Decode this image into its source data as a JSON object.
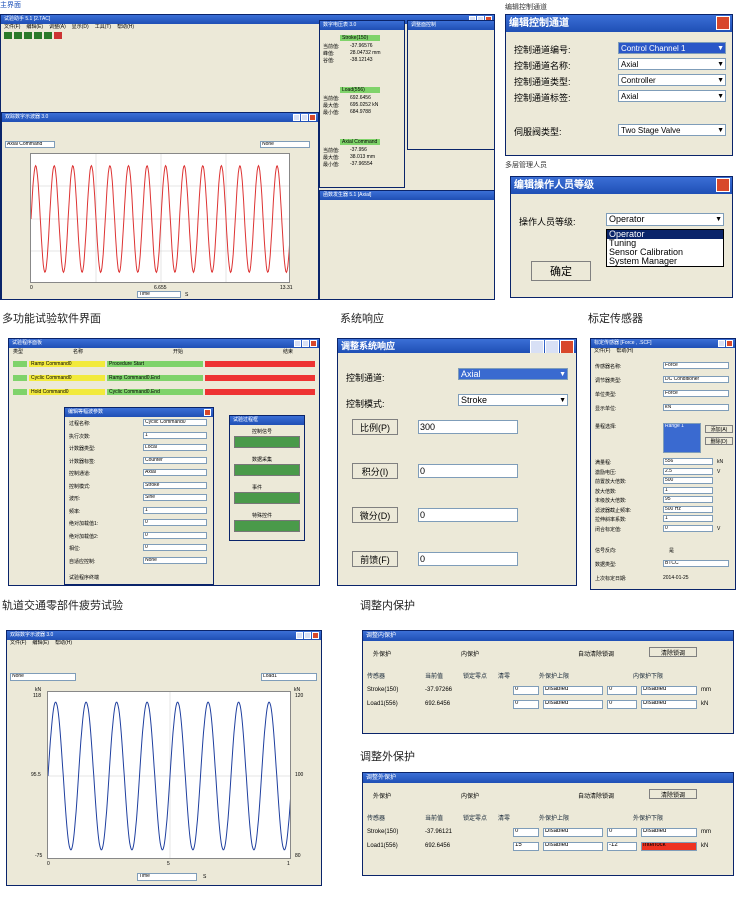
{
  "captions": {
    "main": "主界面",
    "edit_channel": "编辑控制通道",
    "operator": "多层管理人员",
    "software": "多功能试验软件界面",
    "response": "系统响应",
    "calibrate": "标定传感器",
    "rail": "轨道交通零部件疲劳试验",
    "inner": "调整内保护",
    "outer": "调整外保护"
  },
  "channel_dlg": {
    "title": "编辑控制通道",
    "rows": [
      {
        "label": "控制通道编号:",
        "value": "Control Channel 1"
      },
      {
        "label": "控制通道名称:",
        "value": "Axial"
      },
      {
        "label": "控制通道类型:",
        "value": "Controller"
      },
      {
        "label": "控制通道标签:",
        "value": "Axial"
      },
      {
        "label": "伺服阀类型:",
        "value": "Two Stage Valve"
      }
    ]
  },
  "operator_dlg": {
    "title": "编辑操作人员等级",
    "label": "操作人员等级:",
    "selected": "Operator",
    "options": [
      "Operator",
      "Tuning",
      "Sensor Calibration",
      "System Manager"
    ],
    "ok": "确定"
  },
  "main_ui": {
    "title": "试验助手 5.1 [2.TAC]",
    "scope_title": "双踪数字示波器 3.0",
    "meter_title": "数字电压表 3.0",
    "gen_title": "函数发生器 5.1 [Axial]",
    "ctrl_title": "调整面控制",
    "menu": [
      "文件(F)",
      "编辑(E)",
      "调整(A)",
      "显示(D)",
      "工具(T)",
      "帮助(H)"
    ],
    "cmd": "Axial Command",
    "none": "None",
    "time": "Time",
    "sec": "S",
    "x_ticks": [
      "0",
      "6.655",
      "13.31"
    ],
    "meters": [
      {
        "label": "Stroke(150)",
        "line1": "当前值:",
        "line2": "峰值:",
        "line3": "谷值:",
        "v1": "-37.96576",
        "v2": "28.04732 mm",
        "v3": "-38.12143"
      },
      {
        "label": "Load(556)",
        "line1": "当前值:",
        "line2": "最大值:",
        "line3": "最小值:",
        "v1": "692.6456",
        "v2": "695.0252 kN",
        "v3": "684.9788"
      },
      {
        "label": "Axial Command",
        "line1": "当前值:",
        "line2": "最大值:",
        "line3": "最小值:",
        "v1": "-37.956",
        "v2": "38.013 mm",
        "v3": "-37.96554"
      }
    ]
  },
  "rail_ui": {
    "title": "试验程序面板",
    "cols": [
      "类型",
      "名称",
      "开始",
      "结束"
    ],
    "rows": [
      {
        "name": "Ramp Command0",
        "start": "Procedure Start"
      },
      {
        "name": "Cyclic Command0",
        "start": "Ramp Command0.End"
      },
      {
        "name": "Hold Command0",
        "start": "Cyclic Command0.End"
      }
    ],
    "edit_title": "编辑等幅波参数",
    "fields": [
      {
        "label": "过程名称:",
        "value": "Cyclic Command0"
      },
      {
        "label": "执行次数:",
        "value": "1"
      },
      {
        "label": "计数器类型:",
        "value": "Local"
      },
      {
        "label": "计数器标签:",
        "value": "Counter"
      },
      {
        "label": "控制通道:",
        "value": "Axial"
      },
      {
        "label": "控制模式:",
        "value": "Stroke"
      },
      {
        "label": "波形:",
        "value": "Sine"
      },
      {
        "label": "频率:",
        "value": "1"
      },
      {
        "label": "绝对加载值1:",
        "value": "0"
      },
      {
        "label": "绝对加载值2:",
        "value": "0"
      },
      {
        "label": "相位:",
        "value": "0"
      },
      {
        "label": "自适应控制:",
        "value": "None"
      }
    ],
    "allow": "允许",
    "unit_hz": "Hz",
    "times": "Time(s)",
    "deg": "Deg",
    "cycles": "Cycles",
    "footer": "试验程序终端",
    "proc_title": "试验过程框",
    "proc_groups": [
      "控制信号",
      "数据采集",
      "事件",
      "特殊控件"
    ]
  },
  "resp_ui": {
    "title": "调整系统响应",
    "ch_label": "控制通道:",
    "ch_val": "Axial",
    "mode_label": "控制模式:",
    "mode_val": "Stroke",
    "gains": [
      {
        "label": "比例(P)",
        "value": "300"
      },
      {
        "label": "积分(I)",
        "value": "0"
      },
      {
        "label": "微分(D)",
        "value": "0"
      },
      {
        "label": "前馈(F)",
        "value": "0"
      }
    ]
  },
  "cal_ui": {
    "title": "标定传感器 [Force , .SCF]",
    "menu": [
      "文件(F)",
      "帮助(H)"
    ],
    "rows": [
      {
        "label": "传感器名称:",
        "value": "Force"
      },
      {
        "label": "调节器类型:",
        "value": "DC Conditioner"
      },
      {
        "label": "单位类型:",
        "value": "Force"
      },
      {
        "label": "显示单位:",
        "value": "kN"
      }
    ],
    "range_label": "量程选择:",
    "range_val": "Range 1",
    "add": "添加(A)",
    "del": "删除(D)",
    "more": [
      {
        "label": "满量程:",
        "value": "556",
        "unit": "kN"
      },
      {
        "label": "激励电压:",
        "value": "2.5",
        "unit": "V"
      },
      {
        "label": "前置放大倍数:",
        "value": "500",
        "unit": ""
      },
      {
        "label": "放大倍数:",
        "value": "1",
        "unit": ""
      },
      {
        "label": "末级放大倍数:",
        "value": "95",
        "unit": ""
      },
      {
        "label": "滤波器截止频率:",
        "value": "500 Hz",
        "unit": ""
      },
      {
        "label": "拉伸斜率系数:",
        "value": "1",
        "unit": ""
      },
      {
        "label": "闭合标定值:",
        "value": "0",
        "unit": "V"
      }
    ],
    "sign_label": "信号反向:",
    "sign_val": "是",
    "fmt_label": "数据类型:",
    "fmt_val": "BTCC",
    "date_label": "上次标定日期:",
    "date_val": "2014-01-25"
  },
  "scope2": {
    "title": "双踪数字示波器 3.0",
    "menu": [
      "文件(F)",
      "编辑(E)",
      "帮助(H)"
    ],
    "left": "None",
    "right": "Load1",
    "unit_l": "kN",
    "unit_r": "kN",
    "y_left": [
      "118",
      "95.5",
      "-75"
    ],
    "y_right": [
      "120",
      "100",
      "80"
    ],
    "x_ticks": [
      "0",
      "5",
      "1"
    ],
    "time": "Time",
    "sec": "S"
  },
  "prot_inner": {
    "title": "调整内保护",
    "radio_out": "外保护",
    "radio_in": "内保护",
    "auto": "自动清除锁调",
    "clear": "清除锁调",
    "headers": [
      "传感器",
      "当前值",
      "锁定零点",
      "清零",
      "外保护上限",
      "内保护下限"
    ],
    "rows": [
      {
        "name": "Stroke(150)",
        "val": "-37.97266",
        "z": "0",
        "s": "Disabled",
        "v2": "0",
        "s2": "Disabled",
        "u": "mm"
      },
      {
        "name": "Load1(556)",
        "val": "692.6456",
        "z": "0",
        "s": "Disabled",
        "v2": "0",
        "s2": "Disabled",
        "u": "kN"
      }
    ]
  },
  "prot_outer": {
    "title": "调整外保护",
    "radio_out": "外保护",
    "radio_in": "内保护",
    "auto": "自动清除锁调",
    "clear": "清除锁调",
    "headers": [
      "传感器",
      "当前值",
      "锁定零点",
      "清零",
      "外保护上限",
      "外保护下限"
    ],
    "rows": [
      {
        "name": "Stroke(150)",
        "val": "-37.96121",
        "z": "0",
        "s": "Disabled",
        "v2": "0",
        "s2": "Disabled",
        "u": "mm"
      },
      {
        "name": "Load1(556)",
        "val": "692.6456",
        "z": "15",
        "s": "Disabled",
        "v2": "-12",
        "s2": "Interlock",
        "u": "kN"
      }
    ]
  }
}
